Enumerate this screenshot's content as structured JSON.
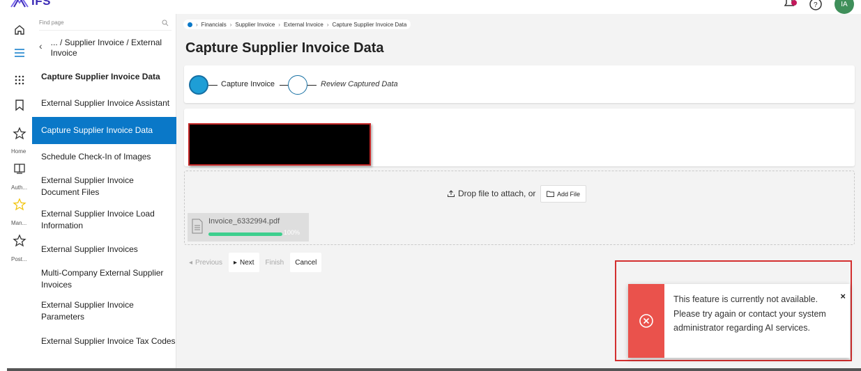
{
  "app": {
    "logo_text": "IFS"
  },
  "header": {
    "avatar_initials": "IA"
  },
  "rail": {
    "labels": [
      "Home",
      "Auth...",
      "Man...",
      "Post..."
    ]
  },
  "nav": {
    "search_placeholder": "Find page",
    "back_text": "... / Supplier Invoice / External Invoice",
    "items": [
      {
        "label": "Capture Supplier Invoice Data"
      },
      {
        "label": "External Supplier Invoice Assistant"
      },
      {
        "label": "Capture Supplier Invoice Data"
      },
      {
        "label": "Schedule Check-In of Images"
      },
      {
        "label": "External Supplier Invoice Document Files"
      },
      {
        "label": "External Supplier Invoice Load Information"
      },
      {
        "label": "External Supplier Invoices"
      },
      {
        "label": "Multi-Company External Supplier Invoices"
      },
      {
        "label": "External Supplier Invoice Parameters"
      },
      {
        "label": "External Supplier Invoice Tax Codes"
      }
    ]
  },
  "breadcrumb": [
    "Financials",
    "Supplier Invoice",
    "External Invoice",
    "Capture Supplier Invoice Data"
  ],
  "page": {
    "title": "Capture Supplier Invoice Data"
  },
  "stepper": {
    "step1": "Capture Invoice",
    "step2": "Review Captured Data"
  },
  "upload": {
    "drop_text": "Drop file to attach, or",
    "add_file_label": "Add File",
    "file_name": "Invoice_6332994.pdf",
    "progress_text": "100%",
    "progress": 1.0
  },
  "toolbar": {
    "previous": "Previous",
    "next": "Next",
    "finish": "Finish",
    "cancel": "Cancel"
  },
  "notification": {
    "message": "This feature is currently not available. Please try again or contact your system administrator regarding AI services.",
    "close": "×"
  },
  "colors": {
    "accent": "#0a78c8",
    "error": "#ea524c",
    "progress": "#3ecf8e"
  }
}
